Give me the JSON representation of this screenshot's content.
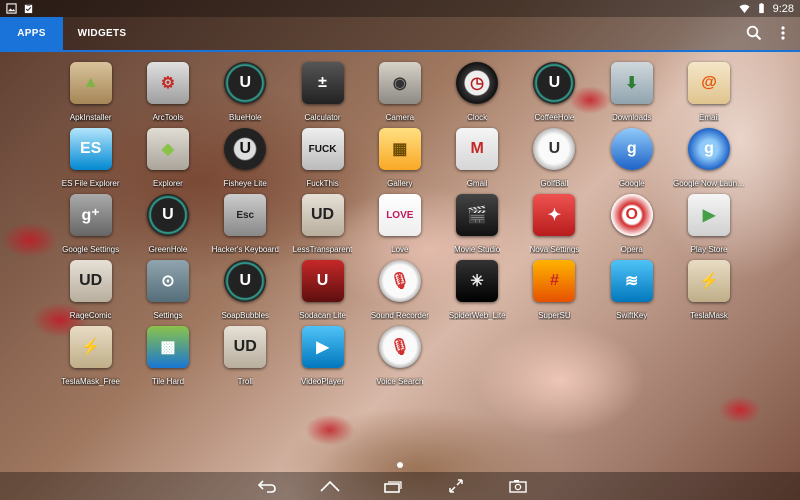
{
  "status_bar": {
    "time": "9:28",
    "icons": [
      "image-notification-icon",
      "clipboard-notification-icon",
      "wifi-icon",
      "battery-icon"
    ]
  },
  "tabs": [
    {
      "label": "APPS",
      "active": true
    },
    {
      "label": "WIDGETS",
      "active": false
    }
  ],
  "header_icons": [
    "search-icon",
    "overflow-menu-icon"
  ],
  "accent_color": "#1a73d8",
  "apps": [
    {
      "label": "ApkInstaller",
      "icon": "android-box-icon"
    },
    {
      "label": "ArcTools",
      "icon": "wrench-gear-icon"
    },
    {
      "label": "BlueHole",
      "icon": "unique-dead-ring-icon"
    },
    {
      "label": "Calculator",
      "icon": "calculator-icon"
    },
    {
      "label": "Camera",
      "icon": "camera-icon"
    },
    {
      "label": "Clock",
      "icon": "clock-icon"
    },
    {
      "label": "CoffeeHole",
      "icon": "unique-dead-ring-icon"
    },
    {
      "label": "Downloads",
      "icon": "download-icon"
    },
    {
      "label": "Email",
      "icon": "email-icon"
    },
    {
      "label": "ES File Explorer",
      "icon": "es-file-explorer-icon"
    },
    {
      "label": "Explorer",
      "icon": "explorer-icon"
    },
    {
      "label": "Fisheye Lite",
      "icon": "fisheye-icon"
    },
    {
      "label": "FuckThis",
      "icon": "fuckthis-icon",
      "icon_text": "FUCK"
    },
    {
      "label": "Gallery",
      "icon": "gallery-icon"
    },
    {
      "label": "Gmail",
      "icon": "gmail-icon"
    },
    {
      "label": "GolfBall",
      "icon": "golfball-icon"
    },
    {
      "label": "Google",
      "icon": "google-search-icon"
    },
    {
      "label": "Google Now Laun…",
      "icon": "google-now-icon"
    },
    {
      "label": "Google Settings",
      "icon": "google-settings-icon"
    },
    {
      "label": "GreenHole",
      "icon": "unique-dead-ring-icon"
    },
    {
      "label": "Hacker's Keyboard",
      "icon": "keyboard-esc-icon",
      "icon_text": "Esc"
    },
    {
      "label": "LessTransparent",
      "icon": "unique-dead-icon"
    },
    {
      "label": "Love",
      "icon": "love-icon",
      "icon_text": "LOVE"
    },
    {
      "label": "Movie Studio",
      "icon": "clapperboard-icon"
    },
    {
      "label": "Nova Settings",
      "icon": "nova-settings-icon"
    },
    {
      "label": "Opera",
      "icon": "opera-icon"
    },
    {
      "label": "Play Store",
      "icon": "play-store-icon"
    },
    {
      "label": "RageComic",
      "icon": "unique-dead-icon"
    },
    {
      "label": "Settings",
      "icon": "settings-toggle-icon"
    },
    {
      "label": "SoapBubbles",
      "icon": "unique-dead-ring-icon"
    },
    {
      "label": "Sodacan Lite",
      "icon": "sodacan-icon"
    },
    {
      "label": "Sound Recorder",
      "icon": "microphone-icon"
    },
    {
      "label": "SpiderWeb_Lite",
      "icon": "spiderweb-icon"
    },
    {
      "label": "SuperSU",
      "icon": "supersu-icon"
    },
    {
      "label": "SwiftKey",
      "icon": "swiftkey-icon"
    },
    {
      "label": "TeslaMask",
      "icon": "teslamask-icon"
    },
    {
      "label": "TeslaMask_Free",
      "icon": "teslamask-icon"
    },
    {
      "label": "Tile Hard",
      "icon": "tile-hard-icon"
    },
    {
      "label": "Troll",
      "icon": "unique-dead-icon"
    },
    {
      "label": "VideoPlayer",
      "icon": "video-player-icon"
    },
    {
      "label": "Voice Search",
      "icon": "microphone-icon"
    }
  ],
  "nav_bar": [
    "back-icon",
    "home-icon",
    "recents-icon",
    "fullscreen-icon",
    "screenshot-icon"
  ]
}
